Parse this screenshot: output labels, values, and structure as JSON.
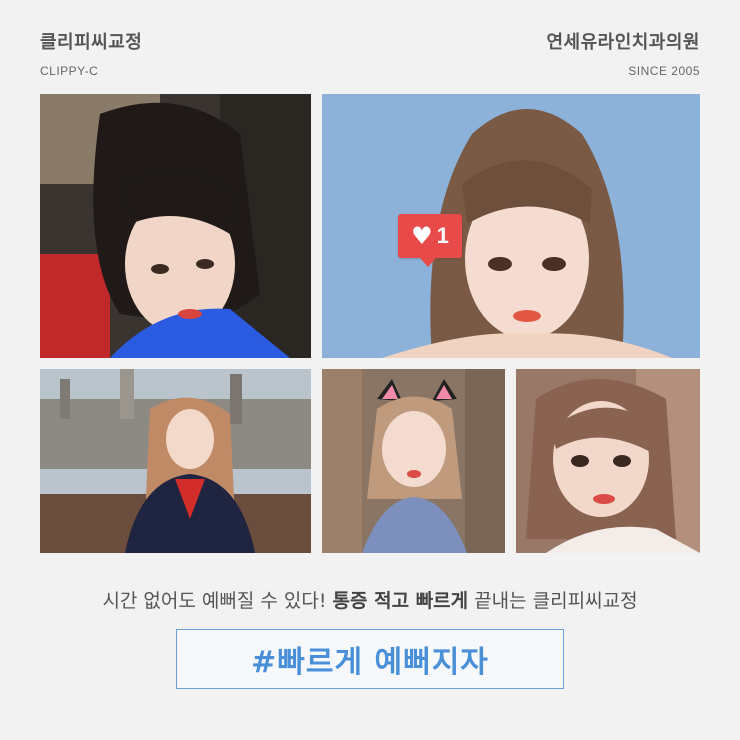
{
  "header": {
    "left_title": "클리피씨교정",
    "left_subtitle": "CLIPPY-C",
    "right_title": "연세유라인치과의원",
    "right_subtitle": "SINCE 2005"
  },
  "photos": [
    {
      "name": "photo-selfie-blue-top"
    },
    {
      "name": "photo-portrait-blue-background"
    },
    {
      "name": "photo-school-uniform-rooftop"
    },
    {
      "name": "photo-cat-ears"
    },
    {
      "name": "photo-selfie-indoor"
    }
  ],
  "like_badge": {
    "icon": "heart-icon",
    "count": "1",
    "color": "#e84a4a"
  },
  "tagline": {
    "part1": "시간 없어도 예뻐질 수 있다!",
    "bold": "통증 적고 빠르게",
    "part2": "끝내는 클리피씨교정"
  },
  "hashtag": {
    "text": "#빠르게 예뻐지자",
    "color": "#4a90d9"
  }
}
